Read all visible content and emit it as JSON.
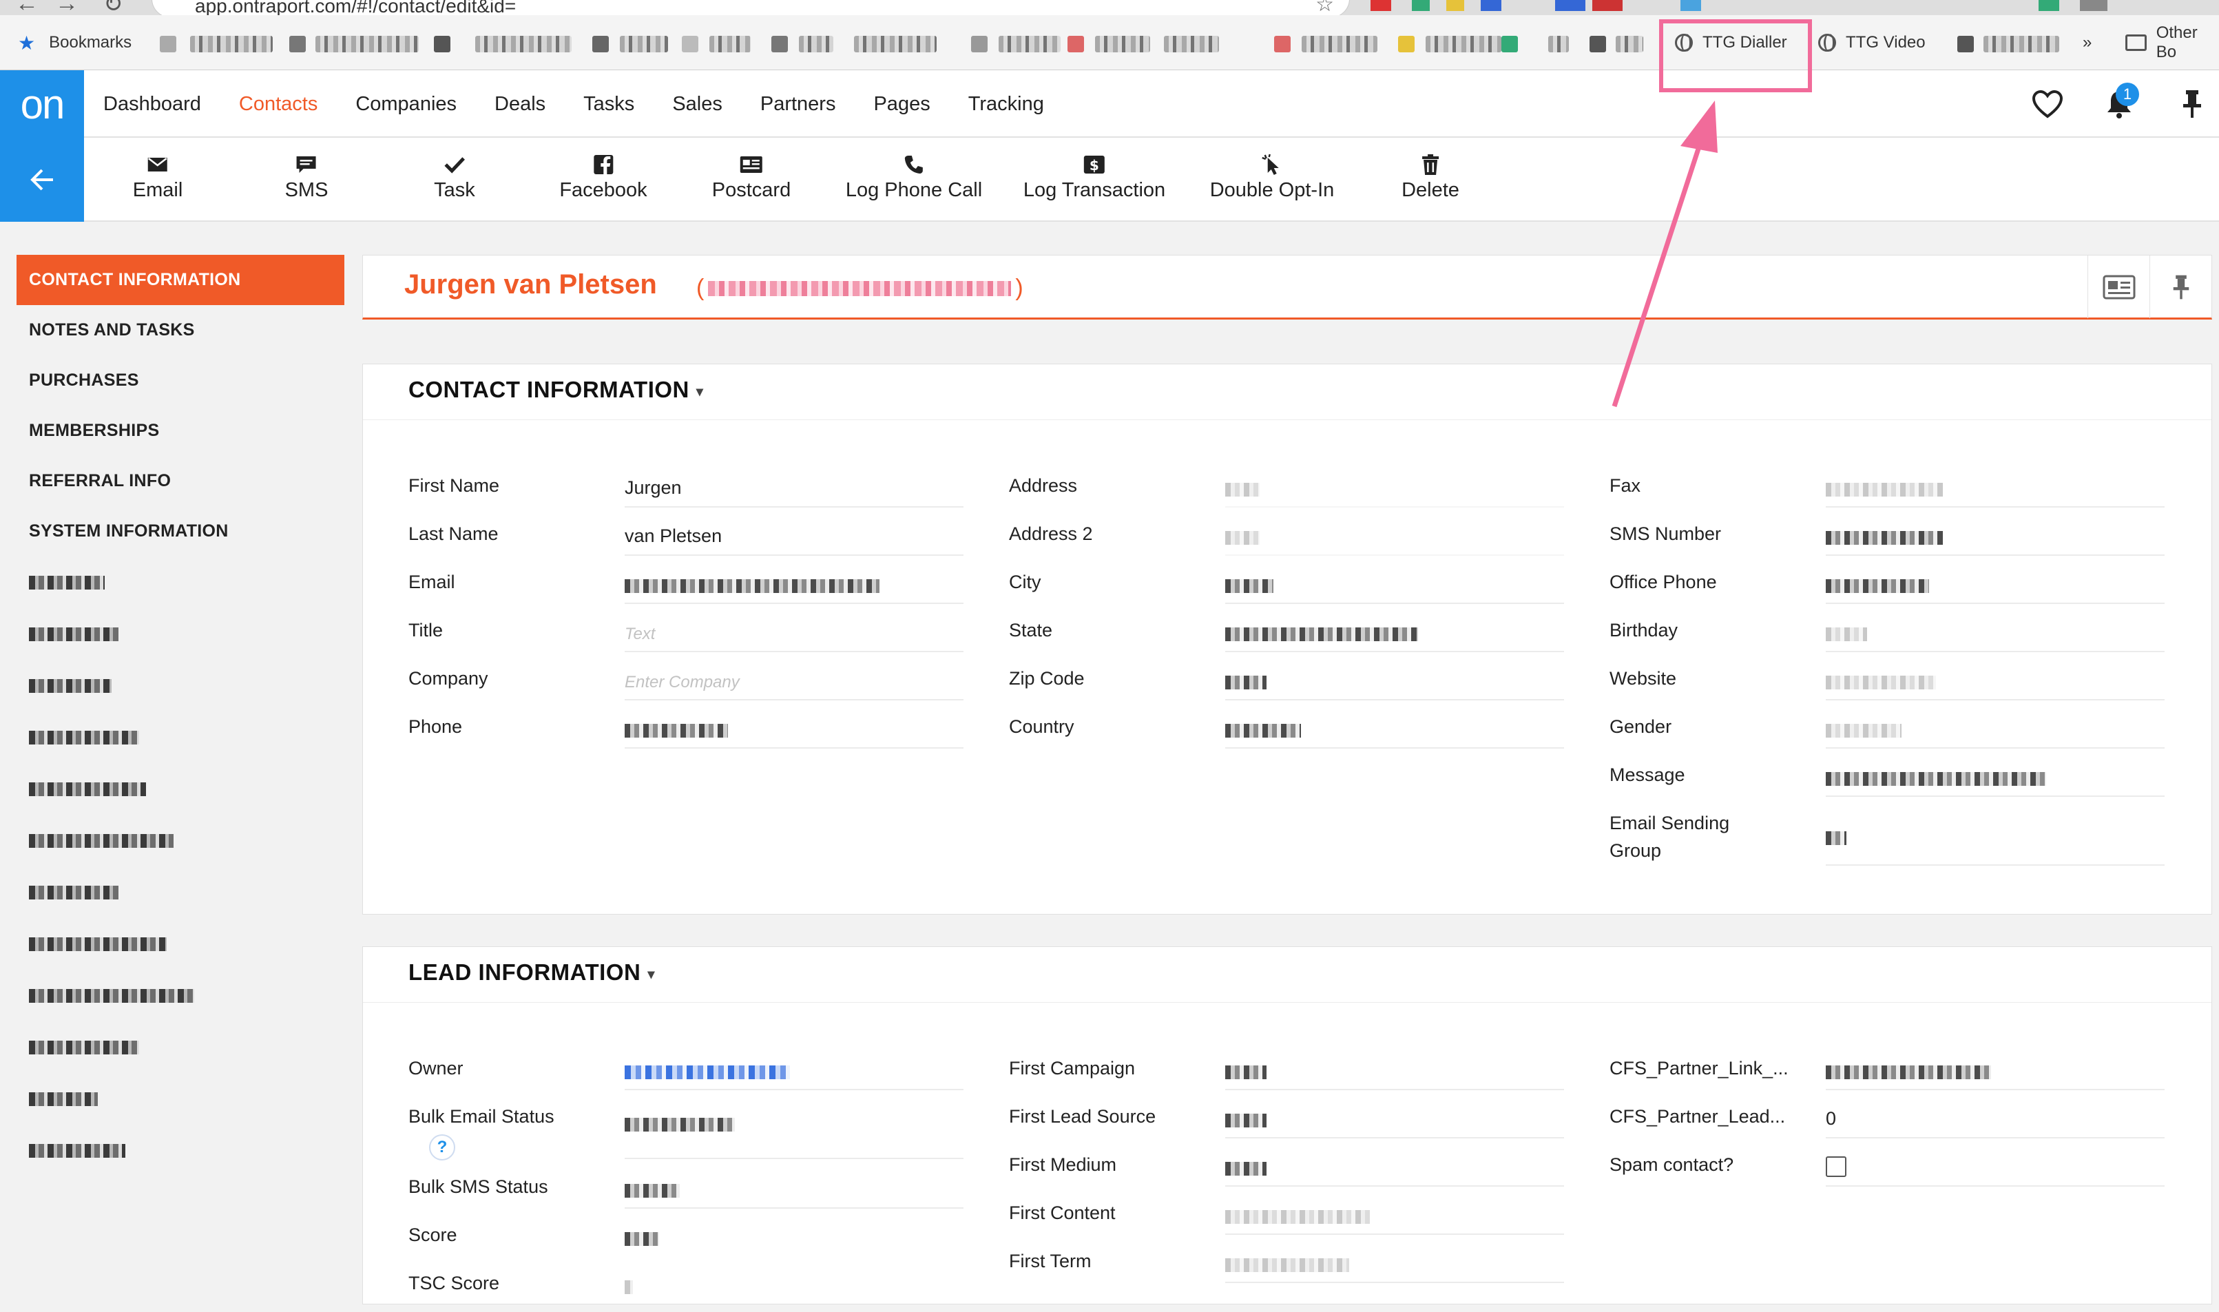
{
  "browser": {
    "url": "app.ontraport.com/#!/contact/edit&id=",
    "bookmarks_label": "Bookmarks",
    "ttg_dialler_label": "TTG Dialler",
    "ttg_video_label": "TTG Video",
    "overflow_label": "»",
    "other_bookmarks_label": "Other Bo"
  },
  "app": {
    "logo_text": "on",
    "nav": [
      "Dashboard",
      "Contacts",
      "Companies",
      "Deals",
      "Tasks",
      "Sales",
      "Partners",
      "Pages",
      "Tracking"
    ],
    "active_nav": "Contacts",
    "notification_count": "1"
  },
  "toolbar": {
    "buttons": [
      {
        "label": "Email",
        "icon": "envelope-icon"
      },
      {
        "label": "SMS",
        "icon": "chat-bubble-icon"
      },
      {
        "label": "Task",
        "icon": "checkmark-icon"
      },
      {
        "label": "Facebook",
        "icon": "facebook-icon"
      },
      {
        "label": "Postcard",
        "icon": "postcard-icon"
      },
      {
        "label": "Log Phone Call",
        "icon": "phone-icon"
      },
      {
        "label": "Log Transaction",
        "icon": "dollar-icon"
      },
      {
        "label": "Double Opt-In",
        "icon": "cursor-click-icon"
      },
      {
        "label": "Delete",
        "icon": "trash-icon"
      }
    ]
  },
  "sidebar": {
    "items": [
      "CONTACT INFORMATION",
      "NOTES AND TASKS",
      "PURCHASES",
      "MEMBERSHIPS",
      "REFERRAL INFO",
      "SYSTEM INFORMATION"
    ],
    "active": "CONTACT INFORMATION"
  },
  "contact": {
    "name": "Jurgen van Pletsen",
    "email_open": "(",
    "email_close": ")"
  },
  "contact_info": {
    "title": "CONTACT INFORMATION",
    "col1": [
      {
        "label": "First Name",
        "value": "Jurgen"
      },
      {
        "label": "Last Name",
        "value": "van Pletsen"
      },
      {
        "label": "Email",
        "value": ""
      },
      {
        "label": "Title",
        "placeholder": "Text"
      },
      {
        "label": "Company",
        "placeholder": "Enter Company"
      },
      {
        "label": "Phone",
        "value": ""
      }
    ],
    "col2": [
      {
        "label": "Address"
      },
      {
        "label": "Address 2"
      },
      {
        "label": "City"
      },
      {
        "label": "State"
      },
      {
        "label": "Zip Code"
      },
      {
        "label": "Country"
      }
    ],
    "col3": [
      {
        "label": "Fax"
      },
      {
        "label": "SMS Number"
      },
      {
        "label": "Office Phone"
      },
      {
        "label": "Birthday"
      },
      {
        "label": "Website"
      },
      {
        "label": "Gender"
      },
      {
        "label": "Message"
      },
      {
        "label": "Email Sending Group"
      }
    ]
  },
  "lead_info": {
    "title": "LEAD INFORMATION",
    "col1": [
      {
        "label": "Owner"
      },
      {
        "label": "Bulk Email Status"
      },
      {
        "label": "Bulk SMS Status"
      },
      {
        "label": "Score"
      },
      {
        "label": "TSC Score"
      }
    ],
    "help_mark": "?",
    "col2": [
      {
        "label": "First Campaign"
      },
      {
        "label": "First Lead Source"
      },
      {
        "label": "First Medium"
      },
      {
        "label": "First Content"
      },
      {
        "label": "First Term"
      }
    ],
    "col3": [
      {
        "label": "CFS_Partner_Link_..."
      },
      {
        "label": "CFS_Partner_Lead...",
        "value": "0"
      },
      {
        "label": "Spam contact?"
      }
    ]
  },
  "colors": {
    "accent": "#f05a28",
    "brand_blue": "#1e90e8",
    "annotation_pink": "#f16b9a"
  }
}
